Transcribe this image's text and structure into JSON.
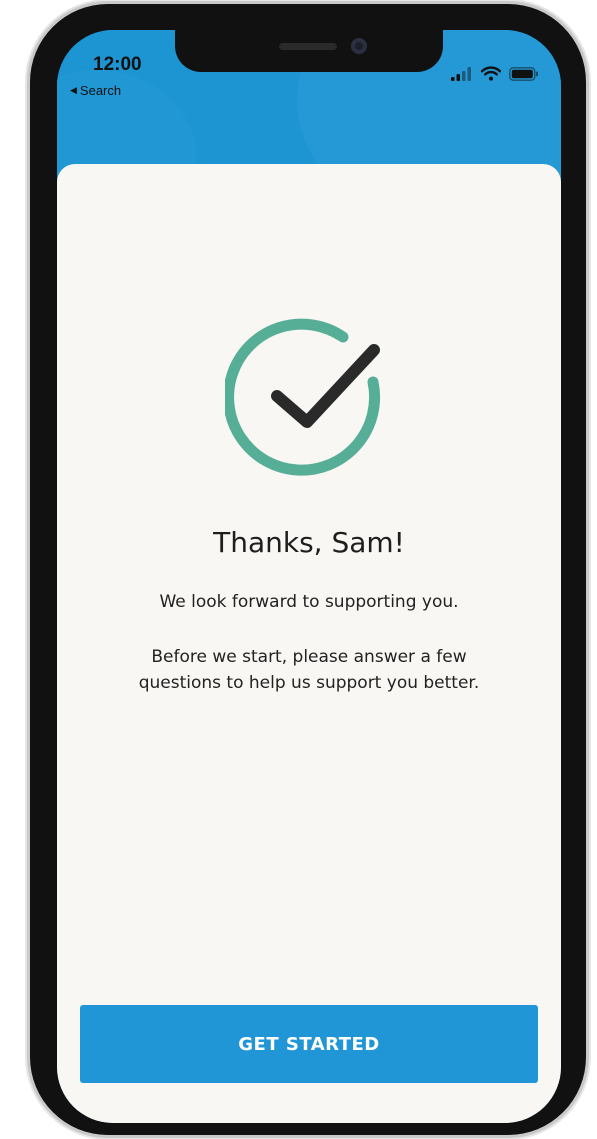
{
  "status_bar": {
    "time": "12:00",
    "back_label": "Search",
    "icons": [
      "cellular-signal-icon",
      "wifi-icon",
      "battery-icon"
    ]
  },
  "confirmation": {
    "icon": "checkmark-circle-icon",
    "title": "Thanks, Sam!",
    "subtitle": "We look forward to supporting you.",
    "body_line1": "Before we start, please answer a few",
    "body_line2": "questions to help us support you better."
  },
  "cta": {
    "label": "GET STARTED"
  },
  "colors": {
    "brand_blue": "#1e95d3",
    "button_blue": "#2196d6",
    "check_green": "#56ae97",
    "check_dark": "#2a2a2a",
    "card_bg": "#f8f7f3"
  }
}
